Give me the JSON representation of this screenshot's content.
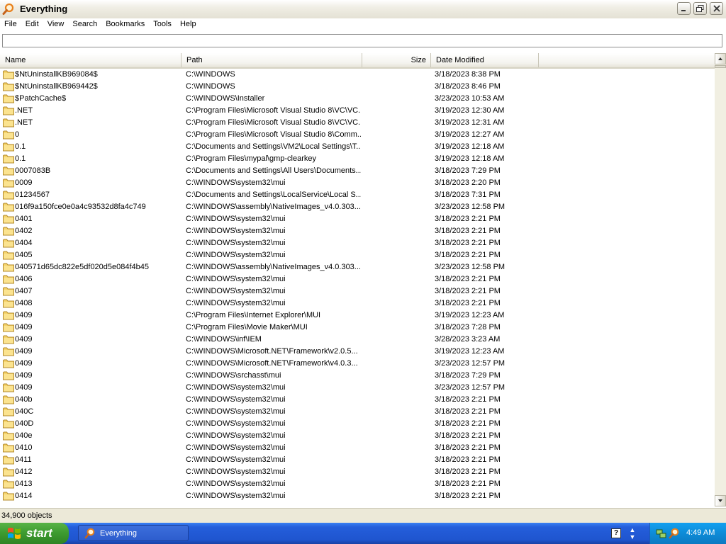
{
  "window": {
    "title": "Everything"
  },
  "menu": [
    "File",
    "Edit",
    "View",
    "Search",
    "Bookmarks",
    "Tools",
    "Help"
  ],
  "search": {
    "value": "",
    "placeholder": ""
  },
  "columns": {
    "name": "Name",
    "path": "Path",
    "size": "Size",
    "date": "Date Modified"
  },
  "rows": [
    {
      "name": "$NtUninstallKB969084$",
      "path": "C:\\WINDOWS",
      "date": "3/18/2023 8:38 PM"
    },
    {
      "name": "$NtUninstallKB969442$",
      "path": "C:\\WINDOWS",
      "date": "3/18/2023 8:46 PM"
    },
    {
      "name": "$PatchCache$",
      "path": "C:\\WINDOWS\\Installer",
      "date": "3/23/2023 10:53 AM"
    },
    {
      "name": ".NET",
      "path": "C:\\Program Files\\Microsoft Visual Studio 8\\VC\\VC...",
      "date": "3/19/2023 12:30 AM"
    },
    {
      "name": ".NET",
      "path": "C:\\Program Files\\Microsoft Visual Studio 8\\VC\\VC...",
      "date": "3/19/2023 12:31 AM"
    },
    {
      "name": "0",
      "path": "C:\\Program Files\\Microsoft Visual Studio 8\\Comm...",
      "date": "3/19/2023 12:27 AM"
    },
    {
      "name": "0.1",
      "path": "C:\\Documents and Settings\\VM2\\Local Settings\\T...",
      "date": "3/19/2023 12:18 AM"
    },
    {
      "name": "0.1",
      "path": "C:\\Program Files\\mypal\\gmp-clearkey",
      "date": "3/19/2023 12:18 AM"
    },
    {
      "name": "0007083B",
      "path": "C:\\Documents and Settings\\All Users\\Documents...",
      "date": "3/18/2023 7:29 PM"
    },
    {
      "name": "0009",
      "path": "C:\\WINDOWS\\system32\\mui",
      "date": "3/18/2023 2:20 PM"
    },
    {
      "name": "01234567",
      "path": "C:\\Documents and Settings\\LocalService\\Local S...",
      "date": "3/18/2023 7:31 PM"
    },
    {
      "name": "016f9a150fce0e0a4c93532d8fa4c749",
      "path": "C:\\WINDOWS\\assembly\\NativeImages_v4.0.303...",
      "date": "3/23/2023 12:58 PM"
    },
    {
      "name": "0401",
      "path": "C:\\WINDOWS\\system32\\mui",
      "date": "3/18/2023 2:21 PM"
    },
    {
      "name": "0402",
      "path": "C:\\WINDOWS\\system32\\mui",
      "date": "3/18/2023 2:21 PM"
    },
    {
      "name": "0404",
      "path": "C:\\WINDOWS\\system32\\mui",
      "date": "3/18/2023 2:21 PM"
    },
    {
      "name": "0405",
      "path": "C:\\WINDOWS\\system32\\mui",
      "date": "3/18/2023 2:21 PM"
    },
    {
      "name": "040571d65dc822e5df020d5e084f4b45",
      "path": "C:\\WINDOWS\\assembly\\NativeImages_v4.0.303...",
      "date": "3/23/2023 12:58 PM"
    },
    {
      "name": "0406",
      "path": "C:\\WINDOWS\\system32\\mui",
      "date": "3/18/2023 2:21 PM"
    },
    {
      "name": "0407",
      "path": "C:\\WINDOWS\\system32\\mui",
      "date": "3/18/2023 2:21 PM"
    },
    {
      "name": "0408",
      "path": "C:\\WINDOWS\\system32\\mui",
      "date": "3/18/2023 2:21 PM"
    },
    {
      "name": "0409",
      "path": "C:\\Program Files\\Internet Explorer\\MUI",
      "date": "3/19/2023 12:23 AM"
    },
    {
      "name": "0409",
      "path": "C:\\Program Files\\Movie Maker\\MUI",
      "date": "3/18/2023 7:28 PM"
    },
    {
      "name": "0409",
      "path": "C:\\WINDOWS\\inf\\IEM",
      "date": "3/28/2023 3:23 AM"
    },
    {
      "name": "0409",
      "path": "C:\\WINDOWS\\Microsoft.NET\\Framework\\v2.0.5...",
      "date": "3/19/2023 12:23 AM"
    },
    {
      "name": "0409",
      "path": "C:\\WINDOWS\\Microsoft.NET\\Framework\\v4.0.3...",
      "date": "3/23/2023 12:57 PM"
    },
    {
      "name": "0409",
      "path": "C:\\WINDOWS\\srchasst\\mui",
      "date": "3/18/2023 7:29 PM"
    },
    {
      "name": "0409",
      "path": "C:\\WINDOWS\\system32\\mui",
      "date": "3/23/2023 12:57 PM"
    },
    {
      "name": "040b",
      "path": "C:\\WINDOWS\\system32\\mui",
      "date": "3/18/2023 2:21 PM"
    },
    {
      "name": "040C",
      "path": "C:\\WINDOWS\\system32\\mui",
      "date": "3/18/2023 2:21 PM"
    },
    {
      "name": "040D",
      "path": "C:\\WINDOWS\\system32\\mui",
      "date": "3/18/2023 2:21 PM"
    },
    {
      "name": "040e",
      "path": "C:\\WINDOWS\\system32\\mui",
      "date": "3/18/2023 2:21 PM"
    },
    {
      "name": "0410",
      "path": "C:\\WINDOWS\\system32\\mui",
      "date": "3/18/2023 2:21 PM"
    },
    {
      "name": "0411",
      "path": "C:\\WINDOWS\\system32\\mui",
      "date": "3/18/2023 2:21 PM"
    },
    {
      "name": "0412",
      "path": "C:\\WINDOWS\\system32\\mui",
      "date": "3/18/2023 2:21 PM"
    },
    {
      "name": "0413",
      "path": "C:\\WINDOWS\\system32\\mui",
      "date": "3/18/2023 2:21 PM"
    },
    {
      "name": "0414",
      "path": "C:\\WINDOWS\\system32\\mui",
      "date": "3/18/2023 2:21 PM"
    }
  ],
  "status": {
    "text": "34,900 objects"
  },
  "taskbar": {
    "start_label": "start",
    "task_label": "Everything",
    "clock": "4:49 AM"
  },
  "icons": {
    "app": "everything-magnifier-icon",
    "folder": "folder-icon",
    "start": "windows-logo-icon",
    "tray": [
      "help-icon",
      "arrows-icon",
      "network-icon",
      "everything-tray-icon"
    ]
  },
  "colors": {
    "taskbar": "#245edb",
    "start": "#3c9a2f",
    "tray": "#0d8bd7",
    "folder": "#f5d36b",
    "app_icon": "#e8801c"
  }
}
